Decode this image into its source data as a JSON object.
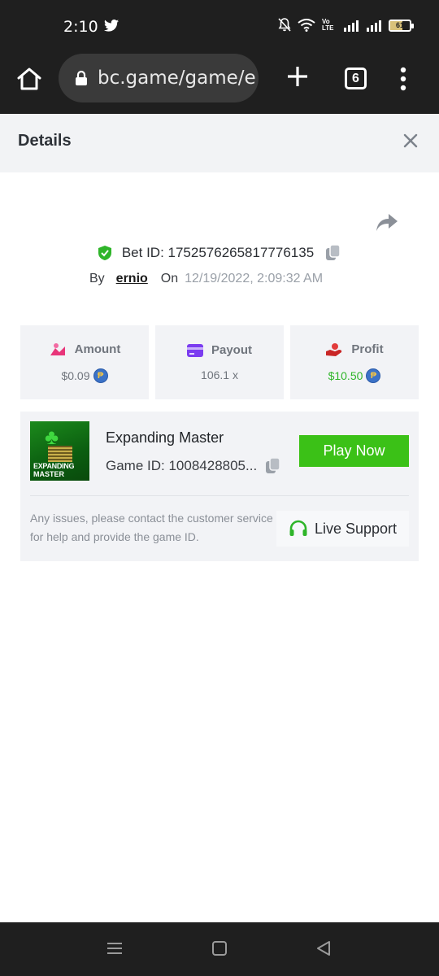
{
  "status": {
    "time": "2:10",
    "battery": "61",
    "network_label": "Vo LTE"
  },
  "browser": {
    "url": "bc.game/game/e",
    "tab_count": "6"
  },
  "details": {
    "title": "Details"
  },
  "bet": {
    "id_label": "Bet ID: 1752576265817776135",
    "by_label": "By",
    "user": "ernio",
    "on_label": "On",
    "date": "12/19/2022, 2:09:32 AM"
  },
  "stats": {
    "amount_label": "Amount",
    "amount_value": "$0.09",
    "payout_label": "Payout",
    "payout_value": "106.1 x",
    "profit_label": "Profit",
    "profit_value": "$10.50"
  },
  "game": {
    "name": "Expanding Master",
    "id_label": "Game ID: 1008428805...",
    "thumb_line1": "EXPANDING",
    "thumb_line2": "MASTER",
    "play_label": "Play Now",
    "issues_text": "Any issues, please contact the customer service for help and provide the game ID.",
    "support_label": "Live Support"
  },
  "colors": {
    "accent_green": "#3bc117",
    "profit_green": "#2fb52a",
    "bar_dark": "#1f1f1f"
  }
}
